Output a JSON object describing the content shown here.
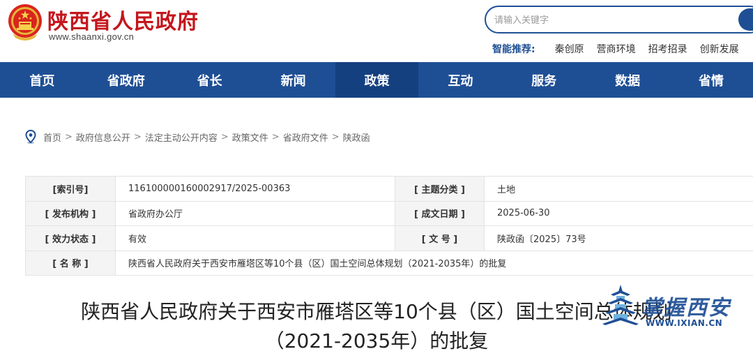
{
  "header": {
    "site_name": "陕西省人民政府",
    "site_url": "www.shaanxi.gov.cn",
    "search_placeholder": "请输入关键字",
    "smart_recommend": {
      "label": "智能推荐:",
      "items": [
        "秦创原",
        "营商环境",
        "招考招录",
        "创新发展"
      ]
    }
  },
  "nav": {
    "items": [
      "首页",
      "省政府",
      "省长",
      "新闻",
      "政策",
      "互动",
      "服务",
      "数据",
      "省情"
    ],
    "active": "政策"
  },
  "breadcrumb": [
    "首页",
    "政府信息公开",
    "法定主动公开内容",
    "政策文件",
    "省政府文件",
    "陕政函"
  ],
  "info": {
    "index_label": "[索引号]",
    "index_value": "11610000016000291​7/2025-00363",
    "topic_label": "[ 主题分类 ]",
    "topic_value": "土地",
    "issuer_label": "[ 发布机构 ]",
    "issuer_value": "省政府办公厅",
    "date_label": "[ 成文日期 ]",
    "date_value": "2025-06-30",
    "status_label": "[ 效力状态 ]",
    "status_value": "有效",
    "docno_label": "[ 文 号 ]",
    "docno_value": "陕政函〔2025〕73号",
    "name_label": "[ 名 称 ]",
    "name_value": "陕西省人民政府关于西安市雁塔区等10个县（区）国土空间总体规划（2021-2035年）的批复"
  },
  "doc_title": {
    "line1": "陕西省人民政府关于西安市雁塔区等10个县（区）国土空间总体规划",
    "line2": "（2021-2035年）的批复"
  },
  "watermark": {
    "text": "掌握西安",
    "url": "WWW.IXIAN.CN"
  },
  "colors": {
    "brand_red": "#c4161c",
    "nav_blue": "#1e4f95",
    "nav_active": "#154080"
  }
}
